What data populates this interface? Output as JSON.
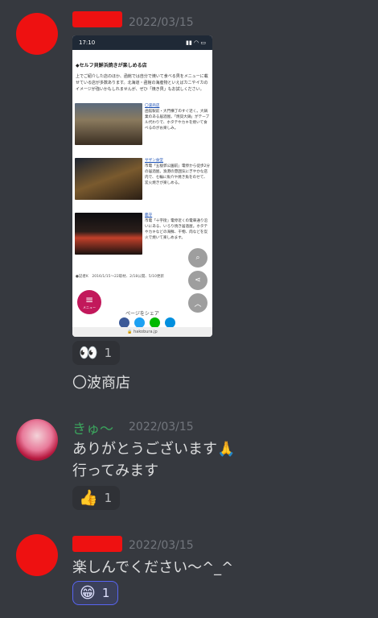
{
  "messages": [
    {
      "timestamp": "2022/03/15",
      "phone": {
        "status_time": "17:10",
        "status_icons": "▮▮ ◠ ▭",
        "title": "◆セルフ貝鮮浜焼きが楽しめる店",
        "intro": "上でご紹介した店のほか、函館では自分で焼いて食べる貝をメニューに載せている店が多数あります。北海道・函館の海産物といえばカニやイカのイメージが強いかもしれませんが、ぜひ「焼き貝」もお試しください。",
        "shops": [
          {
            "name": "〇波商店",
            "desc": "函館駅前・大門横丁のすぐ近く。大鍋業のある居酒屋。「焼貝大鍋」がテーブル代わりで、ホタテやカキを焼いて食べるのがお楽しみ。"
          },
          {
            "name": "サザン食堂",
            "desc": "市電「五稜郭公園前」電停から徒歩2分の居酒屋。漁港の雰囲気にぎやかな店内で、七輪に魚介や焼き魚をのせて、炭火焼きが楽しめる。"
          },
          {
            "name": "鑑守",
            "desc": "市電「十字街」電停近くの電車通り沿いにある、いろり焼き居酒屋。ホタテやカキなどの海鮮、干物、肉などを炭火で焼いて楽しめます。"
          }
        ],
        "footer": "●記者K　2016/1/15〜22取材、2/18公開、5/10更新",
        "menu_label": "メニュー",
        "search_label": "検索",
        "share_btn_label": "シェア",
        "share_title": "ページをシェア",
        "url": "🔒 hakobura.jp"
      },
      "reactions": [
        {
          "emoji": "👀",
          "count": "1"
        }
      ],
      "text": "〇波商店"
    },
    {
      "author": "きゅ〜",
      "timestamp": "2022/03/15",
      "lines": [
        "ありがとうございます🙏",
        "行ってみます"
      ],
      "reactions": [
        {
          "emoji": "👍",
          "count": "1"
        }
      ]
    },
    {
      "timestamp": "2022/03/15",
      "lines": [
        "楽しんでください〜^_^"
      ],
      "reactions": [
        {
          "emoji": "😁",
          "count": "1"
        }
      ]
    }
  ],
  "colors": {
    "background": "#36393f",
    "redact": "#ee1111",
    "username_green": "#3ba55d",
    "reaction_active_border": "#5865f2"
  }
}
